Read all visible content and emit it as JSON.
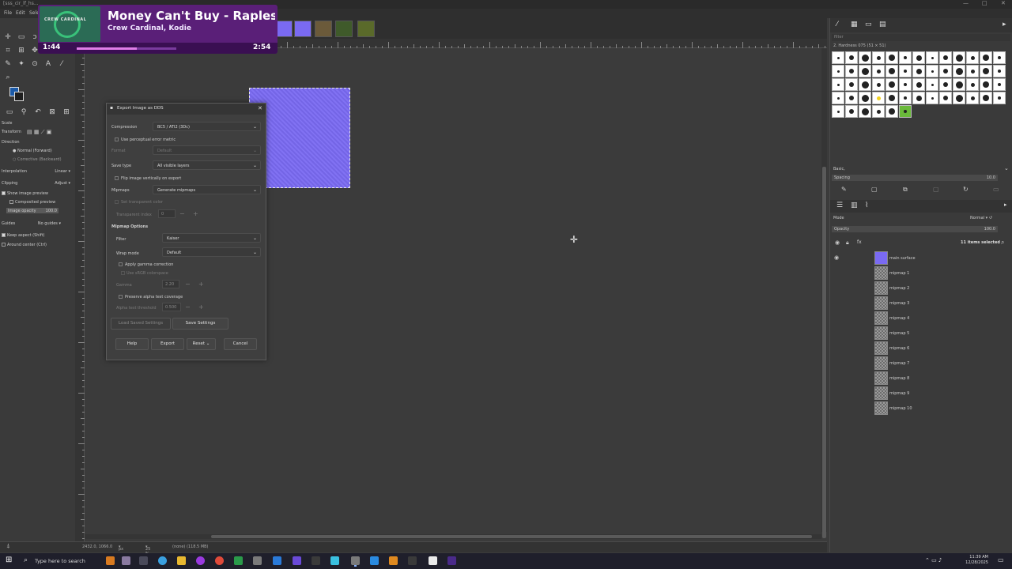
{
  "window": {
    "title": "[sss_cir_lf_hs...",
    "minimize": "—",
    "maximize": "□",
    "close": "✕"
  },
  "menu": [
    "File",
    "Edit",
    "Select"
  ],
  "media": {
    "song": "Money Can't Buy - Rapless Vi",
    "artist": "Crew Cardinal, Kodie",
    "elapsed": "1:44",
    "total": "2:54",
    "progress": 0.6,
    "art_text": "CREW CARDINAL"
  },
  "toolbox": {
    "options": {
      "scale": "Scale",
      "transform": "Transform",
      "direction": "Direction",
      "normal": "Normal (Forward)",
      "corrective": "Corrective (Backward)",
      "interpolation": "Interpolation",
      "interpolation_val": "Linear",
      "clipping": "Clipping",
      "clipping_val": "Adjust",
      "show_preview": "Show image preview",
      "composited": "Composited preview",
      "image_opacity": "Image opacity",
      "image_opacity_val": "100.0",
      "guides": "Guides",
      "guides_val": "No guides",
      "keep_aspect": "Keep aspect (Shift)",
      "around_center": "Around center (Ctrl)"
    }
  },
  "dialog": {
    "title": "Export Image as DDS",
    "compression_label": "Compression",
    "compression_val": "BC5 / ATI2 (3Dc)",
    "perceptual": "Use perceptual error metric",
    "format_label": "Format",
    "format_val": "Default",
    "savetype_label": "Save type",
    "savetype_val": "All visible layers",
    "flip": "Flip image vertically on export",
    "mipmaps_label": "Mipmaps",
    "mipmaps_val": "Generate mipmaps",
    "transparent_color": "Set transparent color",
    "transparent_index_label": "Transparent index",
    "transparent_index_val": "0",
    "mipmap_options": "Mipmap Options",
    "filter_label": "Filter",
    "filter_val": "Kaiser",
    "wrap_label": "Wrap mode",
    "wrap_val": "Default",
    "gamma_correction": "Apply gamma correction",
    "srgb": "Use sRGB colorspace",
    "gamma_label": "Gamma",
    "gamma_val": "2.20",
    "alpha_coverage": "Preserve alpha test coverage",
    "alpha_threshold_label": "Alpha test threshold",
    "alpha_threshold_val": "0.500",
    "load_settings": "Load Saved Settings",
    "save_settings": "Save Settings",
    "help": "Help",
    "export": "Export",
    "reset": "Reset",
    "cancel": "Cancel"
  },
  "status": {
    "coords": "2432.0, 1066.0",
    "unit": "px",
    "zoom": "25 %",
    "info": "(none) (118.5 MB)"
  },
  "brushes": {
    "filter": "filter",
    "current": "2. Hardness 075 (51 × 51)",
    "preset": "Basic,",
    "spacing_label": "Spacing",
    "spacing_val": "10.0"
  },
  "layers": {
    "mode_label": "Mode",
    "mode_val": "Normal",
    "opacity_label": "Opacity",
    "opacity_val": "100.0",
    "selected": "11 items selected",
    "items": [
      "main surface",
      "mipmap 1",
      "mipmap 2",
      "mipmap 3",
      "mipmap 4",
      "mipmap 5",
      "mipmap 6",
      "mipmap 7",
      "mipmap 8",
      "mipmap 9",
      "mipmap 10"
    ]
  },
  "taskbar": {
    "search": "Type here to search",
    "time": "11:39 AM",
    "date": "12/28/2025"
  }
}
